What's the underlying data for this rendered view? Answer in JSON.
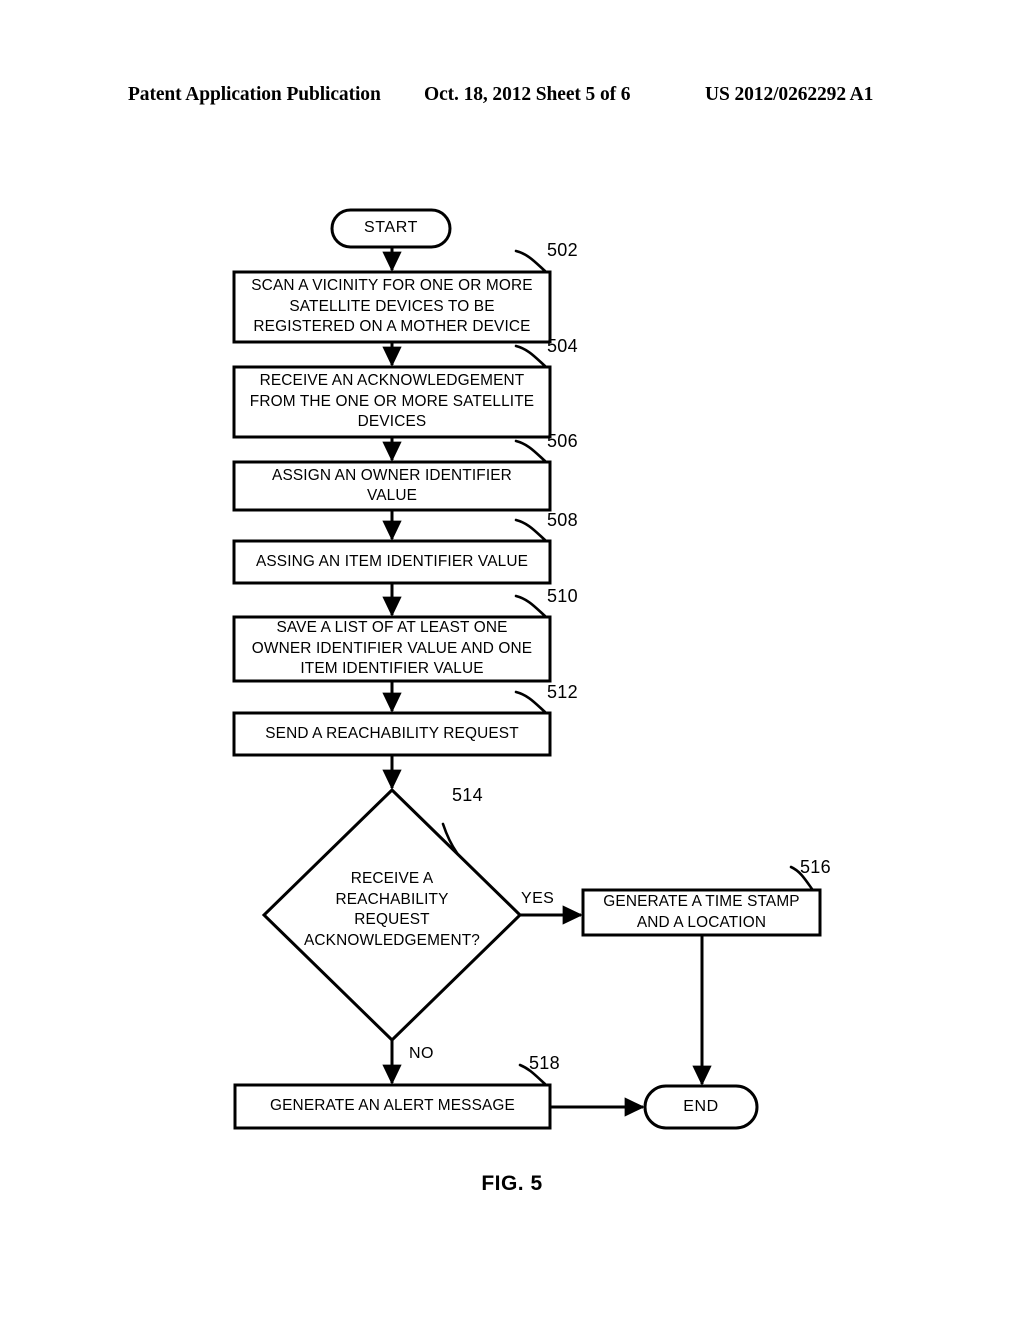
{
  "header": {
    "publication": "Patent Application Publication",
    "date_sheet": "Oct. 18, 2012   Sheet 5 of 6",
    "doc_id": "US 2012/0262292 A1"
  },
  "figure": {
    "caption": "FIG. 5",
    "start_label": "START",
    "end_label": "END",
    "branch_yes": "YES",
    "branch_no": "NO",
    "line_color": "#000000",
    "fill_color": "#ffffff"
  },
  "flowchart": {
    "type": "flowchart",
    "nodes": [
      {
        "id": "start",
        "shape": "terminator",
        "ref": "",
        "text": "START"
      },
      {
        "id": "n502",
        "shape": "process",
        "ref": "502",
        "text": "SCAN A VICINITY FOR ONE OR MORE\nSATELLITE DEVICES TO BE\nREGISTERED ON A MOTHER DEVICE"
      },
      {
        "id": "n504",
        "shape": "process",
        "ref": "504",
        "text": "RECEIVE AN ACKNOWLEDGEMENT\nFROM THE ONE OR MORE SATELLITE\nDEVICES"
      },
      {
        "id": "n506",
        "shape": "process",
        "ref": "506",
        "text": "ASSIGN AN OWNER IDENTIFIER\nVALUE"
      },
      {
        "id": "n508",
        "shape": "process",
        "ref": "508",
        "text": "ASSING AN ITEM IDENTIFIER VALUE"
      },
      {
        "id": "n510",
        "shape": "process",
        "ref": "510",
        "text": "SAVE A LIST OF AT LEAST ONE\nOWNER IDENTIFIER VALUE AND ONE\nITEM IDENTIFIER VALUE"
      },
      {
        "id": "n512",
        "shape": "process",
        "ref": "512",
        "text": "SEND A REACHABILITY REQUEST"
      },
      {
        "id": "n514",
        "shape": "decision",
        "ref": "514",
        "text": "RECEIVE A\nREACHABILITY\nREQUEST\nACKNOWLEDGEMENT?"
      },
      {
        "id": "n516",
        "shape": "process",
        "ref": "516",
        "text": "GENERATE A TIME STAMP\nAND A LOCATION"
      },
      {
        "id": "n518",
        "shape": "process",
        "ref": "518",
        "text": "GENERATE AN ALERT MESSAGE"
      },
      {
        "id": "end",
        "shape": "terminator",
        "ref": "",
        "text": "END"
      }
    ],
    "edges": [
      {
        "from": "start",
        "to": "n502",
        "label": ""
      },
      {
        "from": "n502",
        "to": "n504",
        "label": ""
      },
      {
        "from": "n504",
        "to": "n506",
        "label": ""
      },
      {
        "from": "n506",
        "to": "n508",
        "label": ""
      },
      {
        "from": "n508",
        "to": "n510",
        "label": ""
      },
      {
        "from": "n510",
        "to": "n512",
        "label": ""
      },
      {
        "from": "n512",
        "to": "n514",
        "label": ""
      },
      {
        "from": "n514",
        "to": "n516",
        "label": "YES"
      },
      {
        "from": "n514",
        "to": "n518",
        "label": "NO"
      },
      {
        "from": "n516",
        "to": "end",
        "label": ""
      },
      {
        "from": "n518",
        "to": "end",
        "label": ""
      }
    ]
  }
}
